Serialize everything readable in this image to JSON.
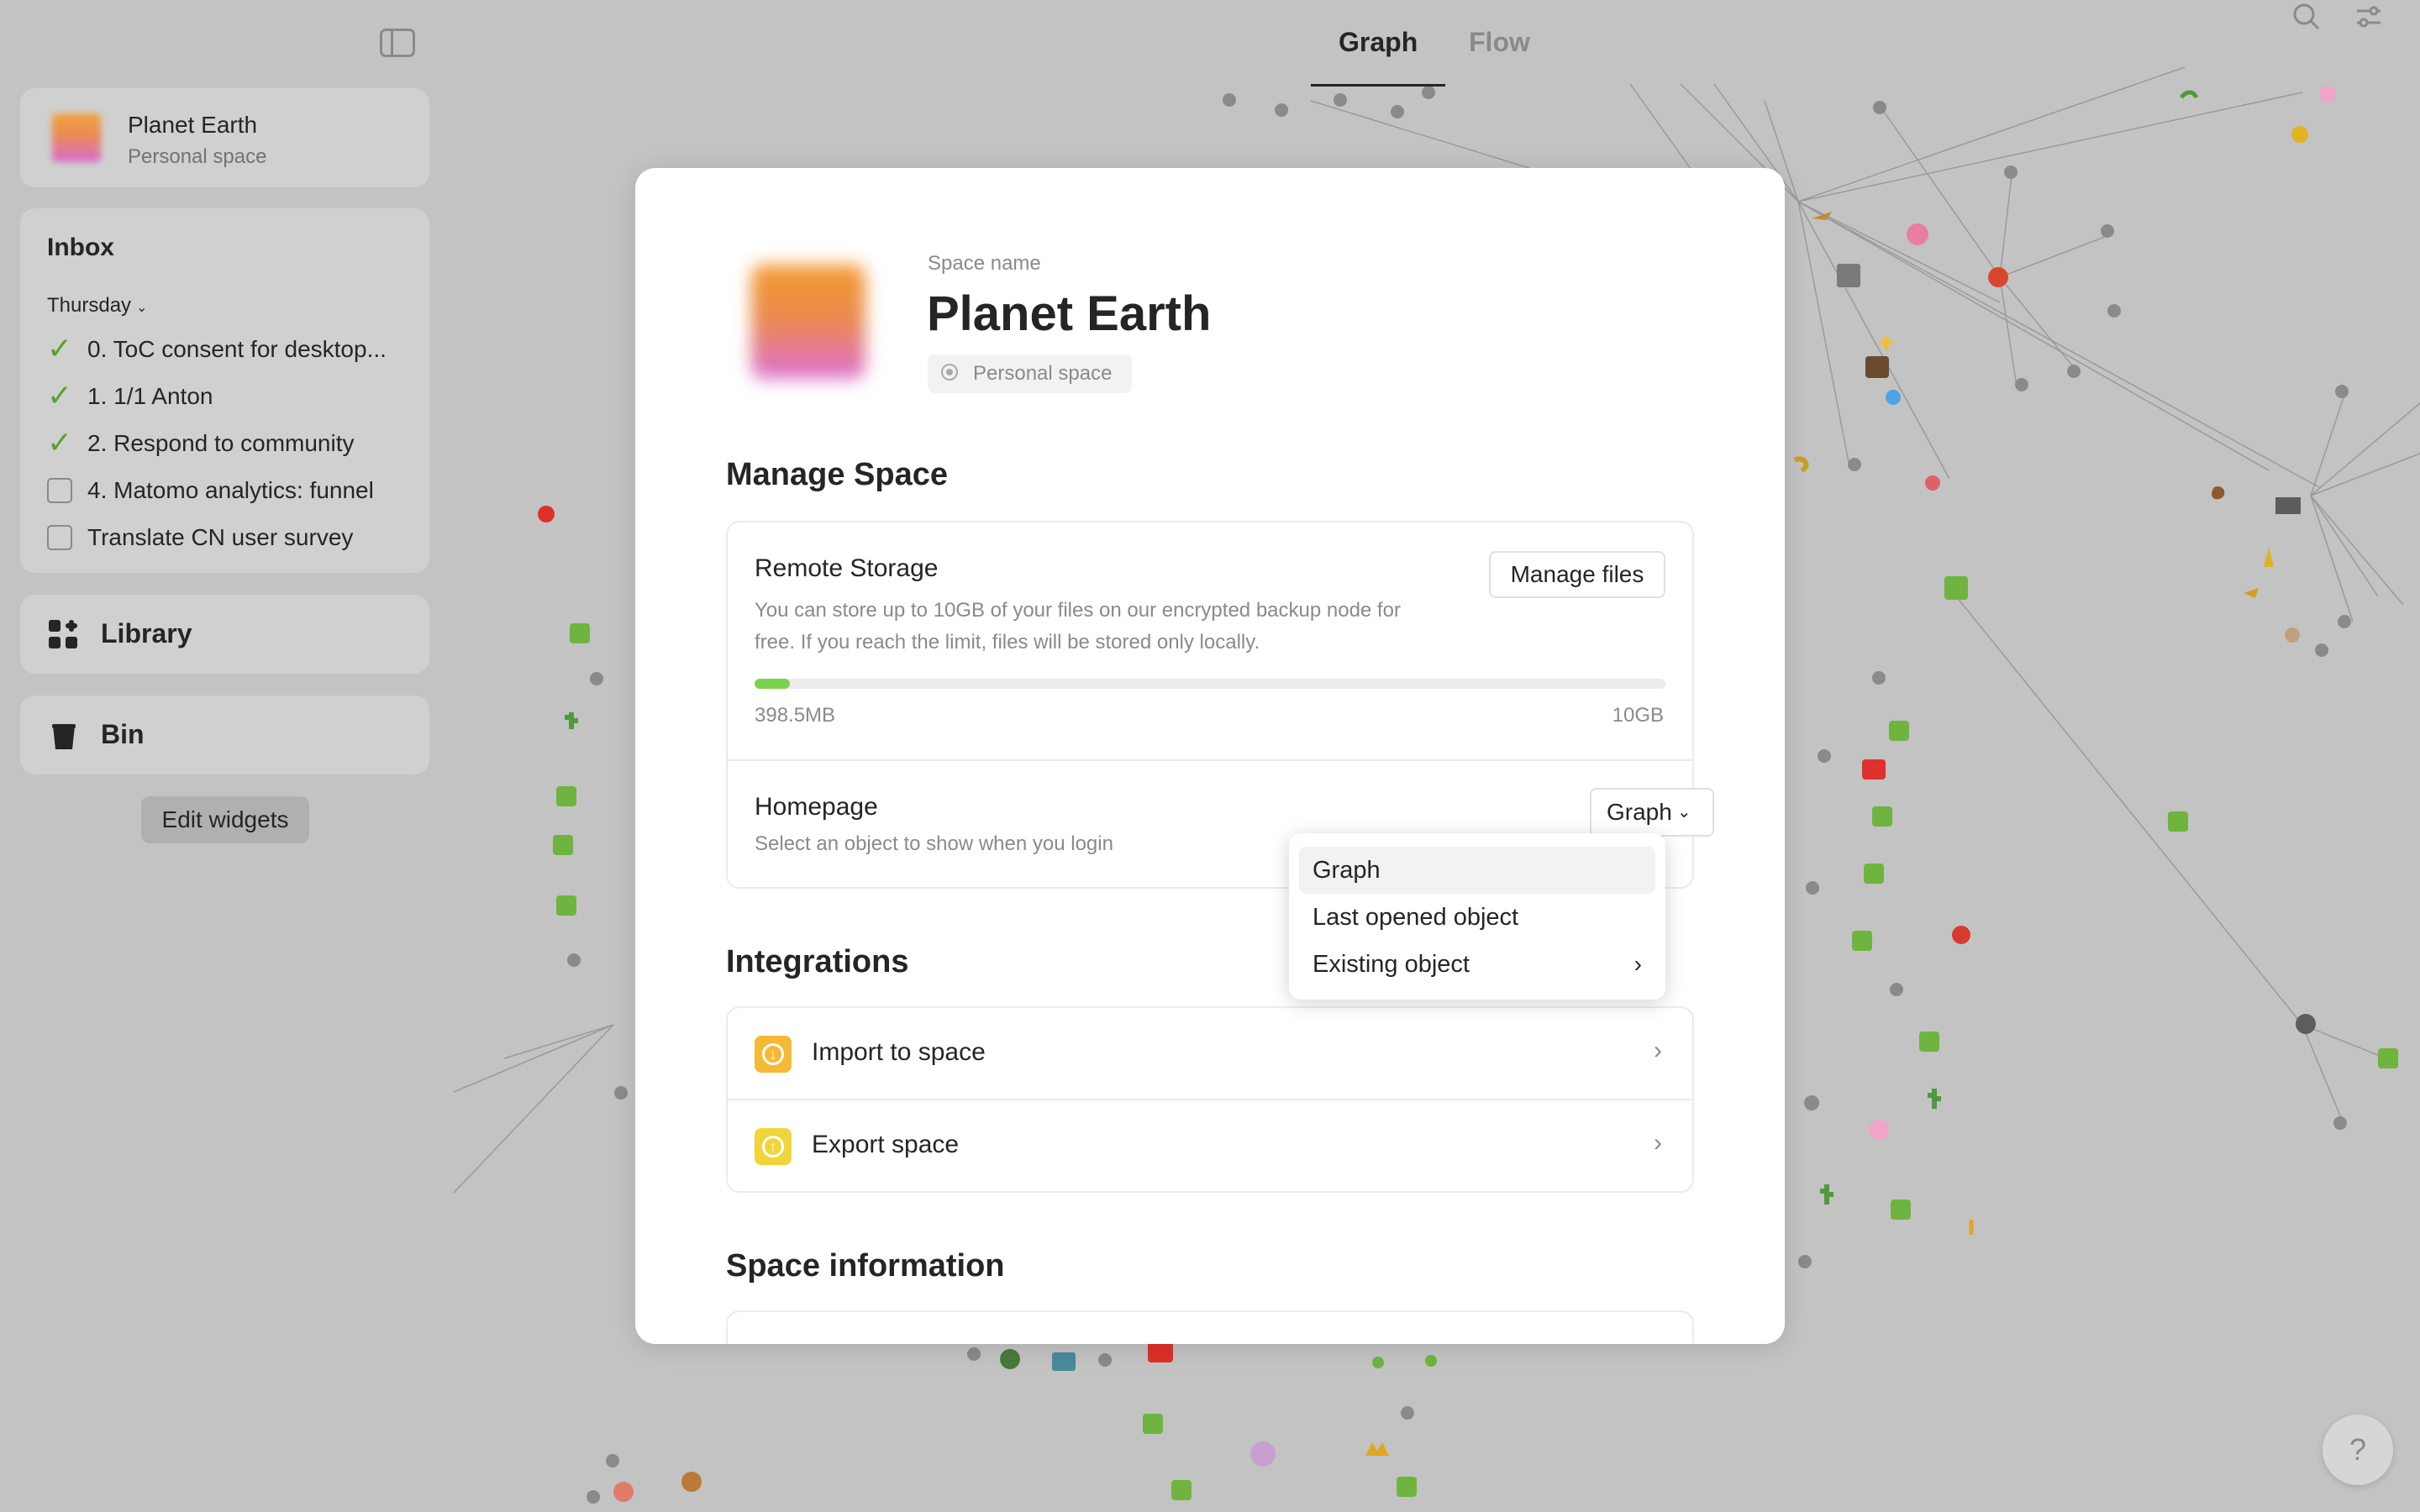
{
  "sidebar": {
    "space": {
      "name": "Planet Earth",
      "type": "Personal space"
    },
    "inbox": {
      "title": "Inbox",
      "filter": "Thursday",
      "tasks": [
        {
          "label": "0. ToC consent for desktop...",
          "done": true
        },
        {
          "label": "1. 1/1 Anton",
          "done": true
        },
        {
          "label": "2. Respond to community",
          "done": true
        },
        {
          "label": "4. Matomo analytics: funnel",
          "done": false
        },
        {
          "label": "Translate CN user survey",
          "done": false
        }
      ]
    },
    "library_label": "Library",
    "bin_label": "Bin",
    "edit_widgets_label": "Edit widgets"
  },
  "header": {
    "tabs": [
      {
        "label": "Graph",
        "active": true
      },
      {
        "label": "Flow",
        "active": false
      }
    ],
    "icons": [
      "search-icon",
      "settings-sliders-icon"
    ]
  },
  "modal": {
    "space_name_label": "Space name",
    "space_name": "Planet Earth",
    "space_type": "Personal space",
    "manage_section": {
      "title": "Manage Space",
      "remote_storage": {
        "title": "Remote Storage",
        "description_line1": "You can store up to 10GB of your files on our encrypted backup node for",
        "description_line2": "free. If you reach the limit, files will be stored only locally.",
        "button": "Manage files",
        "used": "398.5MB",
        "limit": "10GB",
        "used_fraction": 0.039
      },
      "homepage": {
        "title": "Homepage",
        "description": "Select an object to show when you login",
        "selected": "Graph"
      }
    },
    "integrations_section": {
      "title": "Integrations",
      "items": [
        {
          "label": "Import to space",
          "icon": "import-icon",
          "color": "#f5b934"
        },
        {
          "label": "Export space",
          "icon": "export-icon",
          "color": "#efd53a"
        }
      ]
    },
    "info_section": {
      "title": "Space information"
    }
  },
  "dropdown": {
    "options": [
      {
        "label": "Graph",
        "selected": true
      },
      {
        "label": "Last opened object",
        "selected": false
      },
      {
        "label": "Existing object",
        "selected": false,
        "has_submenu": true
      }
    ]
  },
  "help_button": "?",
  "colors": {
    "accent_green": "#7cd14d",
    "check_green": "#5aa02c",
    "sidebar_bg": "#c3c3c3",
    "card_bg": "#d0d0d0"
  }
}
